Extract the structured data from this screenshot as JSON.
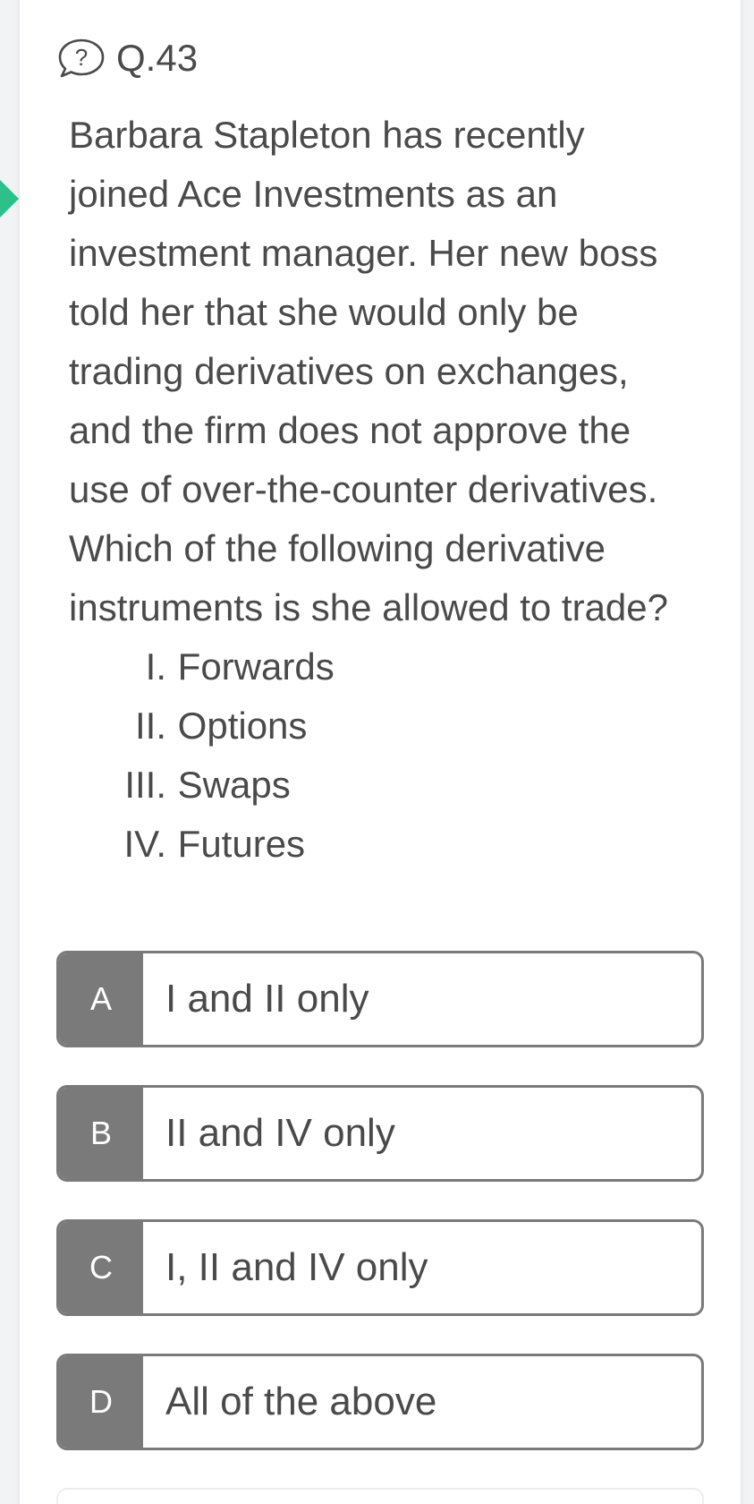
{
  "question": {
    "number_label": "Q.43",
    "icon": "question-bubble-icon",
    "lines": [
      "Barbara Stapleton has recently",
      "joined Ace Investments as an",
      "investment manager. Her new boss",
      "told her that she would only be",
      "trading derivatives on exchanges,",
      "and the firm does not approve the",
      "use of over-the-counter derivatives.",
      "Which of the following derivative",
      "instruments is she allowed to trade?"
    ],
    "statements": [
      {
        "num": "I.",
        "text": "Forwards"
      },
      {
        "num": "II.",
        "text": "Options"
      },
      {
        "num": "III.",
        "text": "Swaps"
      },
      {
        "num": "IV.",
        "text": "Futures"
      }
    ]
  },
  "options": [
    {
      "letter": "A",
      "text": "I and II only"
    },
    {
      "letter": "B",
      "text": "II and IV only"
    },
    {
      "letter": "C",
      "text": "I, II and IV only"
    },
    {
      "letter": "D",
      "text": "All of the above"
    }
  ],
  "colors": {
    "indicator": "#2cc08a",
    "option_border": "#7a7a7a",
    "text": "#4a4a4a"
  }
}
